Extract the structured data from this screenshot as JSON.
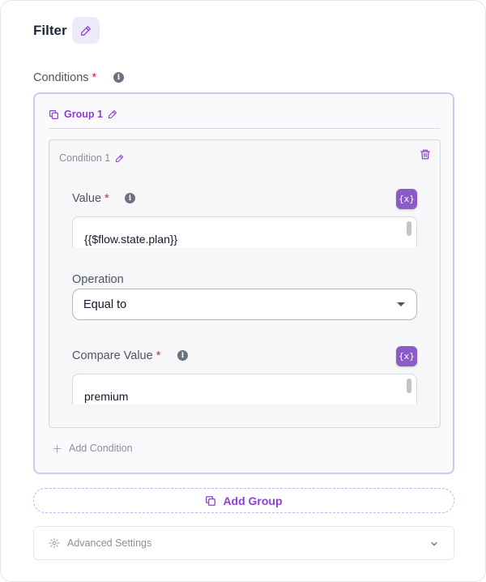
{
  "header": {
    "title": "Filter"
  },
  "conditions_label": "Conditions",
  "required_mark": "*",
  "group": {
    "label": "Group 1",
    "condition": {
      "label": "Condition 1",
      "value_label": "Value",
      "value_text": "{{$flow.state.plan}}",
      "operation_label": "Operation",
      "operation_value": "Equal to",
      "compare_label": "Compare Value",
      "compare_text": "premium",
      "variable_button": "{x}"
    },
    "add_condition": "Add Condition"
  },
  "add_group": "Add Group",
  "advanced_settings": "Advanced Settings",
  "colors": {
    "accent": "#8b3fd9",
    "accent_button": "#8b5cc8",
    "required": "#e11d48",
    "group_border": "#d8c4f0"
  },
  "icons": {
    "edit": "pencil-icon",
    "info": "info-icon",
    "group": "copy-icon",
    "delete": "trash-icon",
    "variable": "variable-icon",
    "add": "plus-icon",
    "settings": "gear-icon",
    "expand": "chevron-down-icon",
    "select": "caret-down-icon"
  }
}
